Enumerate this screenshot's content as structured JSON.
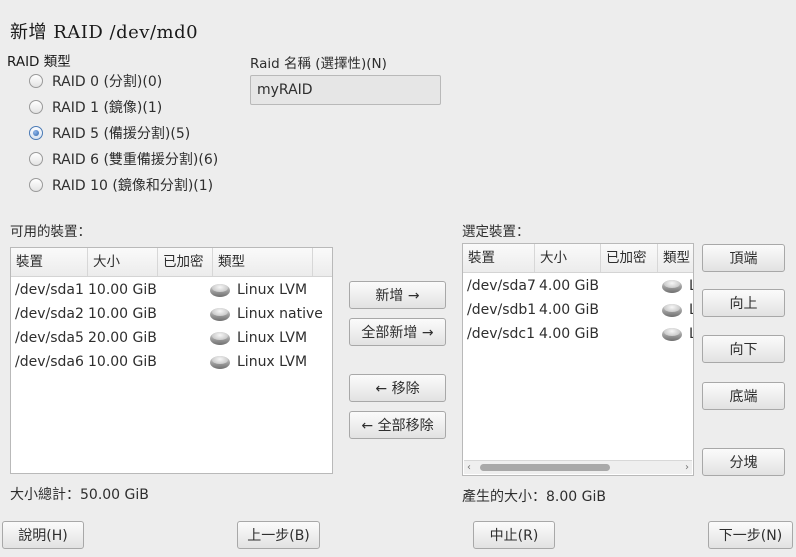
{
  "dialog": {
    "title": "新增  RAID  /dev/md0"
  },
  "raid_type": {
    "label": "RAID 類型",
    "options": [
      {
        "label": "RAID 0 (分割)(0)",
        "checked": false
      },
      {
        "label": "RAID 1 (鏡像)(1)",
        "checked": false
      },
      {
        "label": "RAID 5 (備援分割)(5)",
        "checked": true
      },
      {
        "label": "RAID 6 (雙重備援分割)(6)",
        "checked": false
      },
      {
        "label": "RAID 10 (鏡像和分割)(1)",
        "checked": false
      }
    ]
  },
  "raid_name": {
    "label": "Raid 名稱 (選擇性)(N)",
    "value": "myRAID"
  },
  "available": {
    "label": "可用的裝置：",
    "columns": [
      "裝置",
      "大小",
      "已加密",
      "類型"
    ],
    "rows": [
      {
        "device": "/dev/sda1",
        "size": "10.00 GiB",
        "encrypted": "",
        "type": "Linux LVM"
      },
      {
        "device": "/dev/sda2",
        "size": "10.00 GiB",
        "encrypted": "",
        "type": "Linux native"
      },
      {
        "device": "/dev/sda5",
        "size": "20.00 GiB",
        "encrypted": "",
        "type": "Linux LVM"
      },
      {
        "device": "/dev/sda6",
        "size": "10.00 GiB",
        "encrypted": "",
        "type": "Linux LVM"
      }
    ],
    "total": "大小總計：50.00 GiB"
  },
  "middle_buttons": {
    "add": "新增 →",
    "add_all": "全部新增 →",
    "remove": "← 移除",
    "remove_all": "← 全部移除"
  },
  "selected": {
    "label": "選定裝置：",
    "columns": [
      "裝置",
      "大小",
      "已加密",
      "類型"
    ],
    "rows": [
      {
        "device": "/dev/sda7",
        "size": "4.00 GiB",
        "encrypted": "",
        "type": "L"
      },
      {
        "device": "/dev/sdb1",
        "size": "4.00 GiB",
        "encrypted": "",
        "type": "L"
      },
      {
        "device": "/dev/sdc1",
        "size": "4.00 GiB",
        "encrypted": "",
        "type": "L"
      }
    ],
    "result_size": "產生的大小：8.00 GiB"
  },
  "order_buttons": {
    "top": "頂端",
    "up": "向上",
    "down": "向下",
    "bottom": "底端",
    "chunk": "分塊"
  },
  "footer": {
    "help": "說明(H)",
    "back": "上一步(B)",
    "abort": "中止(R)",
    "next": "下一步(N)"
  },
  "colors": {
    "background": "#ededed",
    "list_background": "#ffffff",
    "radio_accent": "#2f66ad"
  }
}
